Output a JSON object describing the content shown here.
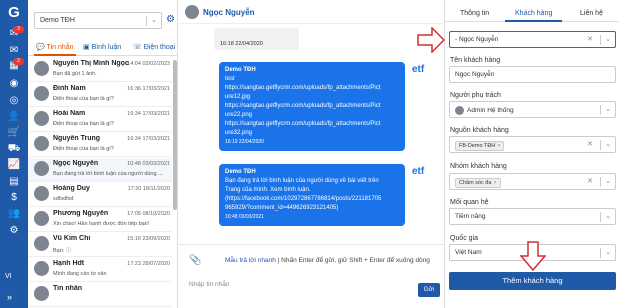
{
  "rail": {
    "logo": "G",
    "badges": [
      "3",
      "",
      "2"
    ],
    "language": "VI",
    "collapse": "»"
  },
  "list": {
    "page_select": "Demo TĐH",
    "tabs": [
      "Tin nhắn",
      "Bình luận",
      "Điện thoại"
    ],
    "conversations": [
      {
        "name": "Nguyễn Thị Minh Ngọc",
        "time": "14:04 03/02/2023",
        "preview": "Bạn đã gửi 1 ảnh."
      },
      {
        "name": "Đinh Nam",
        "time": "16:36 17/03/2021",
        "preview": "Điện thoại của bạn là gì?"
      },
      {
        "name": "Hoài Nam",
        "time": "16:34 17/03/2021",
        "preview": "Điện thoại của bạn là gì?"
      },
      {
        "name": "Nguyễn Trung",
        "time": "16:34 17/03/2021",
        "preview": "Điện thoại của bạn là gì?"
      },
      {
        "name": "Ngọc Nguyễn",
        "time": "10:48 03/03/2021",
        "preview": "Bạn đang trả lời bình luận của người dùng ..."
      },
      {
        "name": "Hoàng Duy",
        "time": "17:20 18/11/2020",
        "preview": "sdfsdfsd"
      },
      {
        "name": "Phương Nguyễn",
        "time": "17:05 08/10/2020",
        "preview": "Xin chào! Hân hạnh được đón tiếp bạn!"
      },
      {
        "name": "Vũ Kim Chi",
        "time": "15:16 23/09/2020",
        "preview": "Bạn: ⓘ"
      },
      {
        "name": "Hạnh Hdt",
        "time": "17:23 28/07/2020",
        "preview": "Mình đang cần tư vấn"
      },
      {
        "name": "Tin nhắn",
        "time": "",
        "preview": ""
      }
    ]
  },
  "chat": {
    "contact_name": "Ngọc Nguyễn",
    "old_message_time": "16:18 22/04/2020",
    "messages": [
      {
        "sender": "Demo TĐH",
        "lines": [
          "test",
          "https://sangtao.getflycrm.com/uploads/fp_attachments/Pict",
          "ure12.jpg",
          "https://sangtao.getflycrm.com/uploads/fp_attachments/Pict",
          "ure22.png",
          "https://sangtao.getflycrm.com/uploads/fp_attachments/Pict",
          "ure32.png"
        ],
        "time": "16:19 22/04/2020",
        "brand": "etf"
      },
      {
        "sender": "Demo TĐH",
        "lines": [
          "Bạn đang trả lời bình luận của người dùng về bài viết trên",
          "Trang của mình. Xem bình luận.",
          "(https://facebook.com/102972867786814/posts/221181705",
          "965929/?comment_id=449626923121405)"
        ],
        "time": "10:48 03/03/2021",
        "brand": "etf"
      }
    ],
    "quick_reply_label": "Mẫu trả lời nhanh",
    "hint": " | Nhấn Enter để gửi, giữ Shift + Enter để xuống dòng",
    "input_placeholder": "Nhập tin nhắn",
    "send_label": "Gửi"
  },
  "panel": {
    "tabs": [
      "Thông tin",
      "Khách hàng",
      "Liên hệ"
    ],
    "search_value": "- Ngọc Nguyễn",
    "fields": [
      {
        "label": "Tên khách hàng",
        "value": "Ngọc Nguyễn"
      },
      {
        "label": "Người phụ trách",
        "value": "Admin Hệ thống"
      },
      {
        "label": "Nguồn khách hàng",
        "value": "FB-Demo TĐH"
      },
      {
        "label": "Nhóm khách hàng",
        "value": "Chăm sóc đa"
      },
      {
        "label": "Mối quan hệ",
        "value": "Tiềm năng"
      },
      {
        "label": "Quốc gia",
        "value": "Việt Nam"
      }
    ],
    "add_button": "Thêm khách hàng"
  },
  "colors": {
    "brand_blue": "#1e5aa8",
    "bubble_blue": "#1a73e8",
    "active_tab_orange": "#e65100",
    "annotation_red": "#d32f2f"
  }
}
